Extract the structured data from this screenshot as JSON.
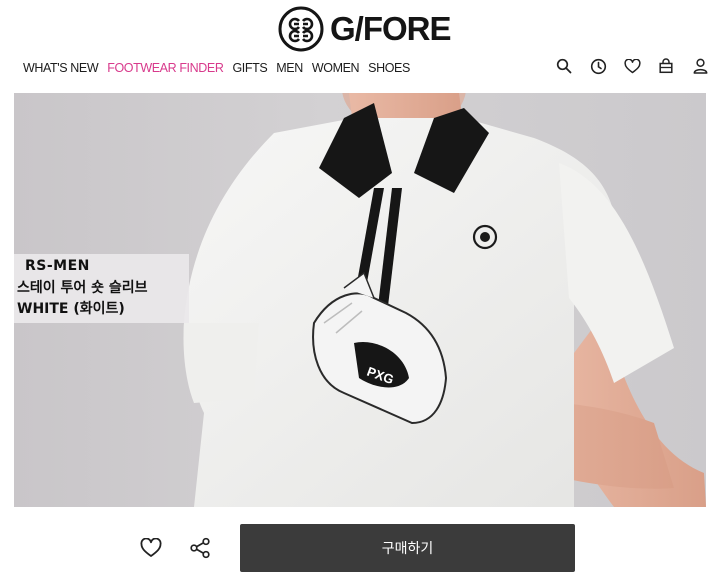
{
  "brand": {
    "name": "G/FORE"
  },
  "nav": {
    "items": [
      {
        "label": "WHAT'S NEW"
      },
      {
        "label": "FOOTWEAR FINDER",
        "accent": true
      },
      {
        "label": "GIFTS"
      },
      {
        "label": "MEN"
      },
      {
        "label": "WOMEN"
      },
      {
        "label": "SHOES"
      }
    ],
    "accent_color": "#d83a8c"
  },
  "utility_icons": [
    "search-icon",
    "recent-clock-icon",
    "wishlist-heart-icon",
    "shopping-bag-icon",
    "account-user-icon"
  ],
  "hero": {
    "caption": {
      "line1": "RS-MEN",
      "line2": "스테이 투어 숏 슬리브",
      "line3": "WHITE (화이트)"
    },
    "glove_brand": "PXG"
  },
  "actions": {
    "wishlist_icon": "heart-icon",
    "share_icon": "share-icon",
    "buy_label": "구매하기",
    "buy_color": "#3b3b3b"
  }
}
